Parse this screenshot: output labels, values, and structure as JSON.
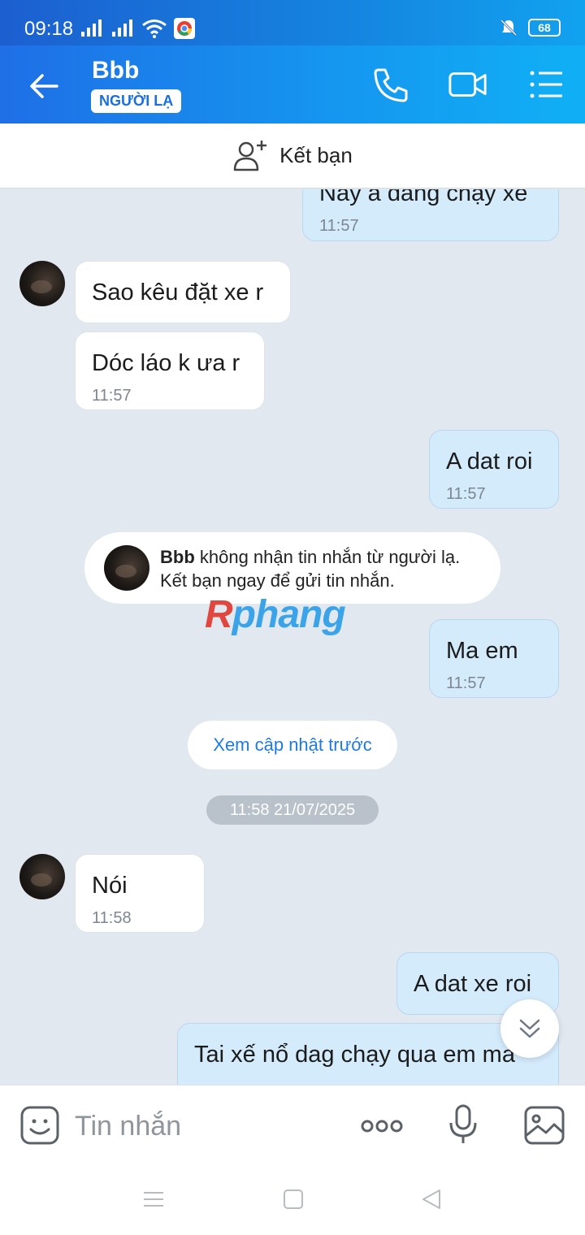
{
  "status_bar": {
    "time": "09:18",
    "battery": "68"
  },
  "header": {
    "contact_name": "Bbb",
    "badge": "NGƯỜI LẠ"
  },
  "add_friend": {
    "label": "Kết bạn"
  },
  "messages": {
    "m0": {
      "text": "Nay a đang chạy xe",
      "time": "11:57"
    },
    "m1": {
      "text": "Sao kêu đặt xe r"
    },
    "m2": {
      "text": "Dóc láo k ưa r",
      "time": "11:57"
    },
    "m3": {
      "text": "A dat roi",
      "time": "11:57"
    },
    "m4": {
      "text": "Ma em",
      "time": "11:57"
    },
    "m5": {
      "text": "Nói",
      "time": "11:58"
    },
    "m6": {
      "text": "A dat xe roi"
    },
    "m7": {
      "text": "Tai xế nổ dag chạy qua em ma"
    }
  },
  "notice": {
    "name": "Bbb",
    "line1": " không nhận tin nhắn từ người lạ.",
    "line2": "Kết bạn ngay để gửi tin nhắn."
  },
  "watermark": {
    "first": "R",
    "rest": "phang"
  },
  "load_previous": "Xem cập nhật trước",
  "date_separator": "11:58 21/07/2025",
  "composer": {
    "placeholder": "Tin nhắn"
  },
  "colors": {
    "accent": "#1a6fe0",
    "outgoing_bubble": "#d4ebfc",
    "incoming_bubble": "#ffffff",
    "chat_bg": "#e2e8ef"
  }
}
